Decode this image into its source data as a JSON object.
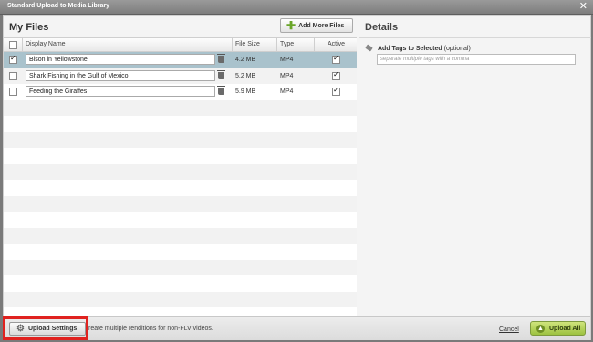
{
  "window": {
    "title": "Standard Upload to Media Library",
    "close_glyph": "✕"
  },
  "files_panel": {
    "title": "My Files",
    "add_more_label": "Add More Files",
    "columns": {
      "display_name": "Display Name",
      "file_size": "File Size",
      "type": "Type",
      "active": "Active"
    },
    "files": [
      {
        "name": "Bison in Yellowstone",
        "size": "4.2 MB",
        "type": "MP4",
        "selected": true,
        "active": true
      },
      {
        "name": "Shark Fishing in the Gulf of Mexico",
        "size": "5.2 MB",
        "type": "MP4",
        "selected": false,
        "active": true
      },
      {
        "name": "Feeding the Giraffes",
        "size": "5.9 MB",
        "type": "MP4",
        "selected": false,
        "active": true
      }
    ]
  },
  "details_panel": {
    "title": "Details",
    "tags_label": "Add Tags to Selected",
    "tags_optional": "(optional)",
    "tags_placeholder": "separate multiple tags with a comma"
  },
  "footer": {
    "settings_label": "Upload Settings",
    "note": "reate multiple renditions for non-FLV videos.",
    "cancel_label": "Cancel",
    "upload_all_label": "Upload All"
  },
  "colors": {
    "selected_row": "#a9c2cc",
    "highlight": "#e0221f",
    "upload_button": "#9dc241"
  }
}
